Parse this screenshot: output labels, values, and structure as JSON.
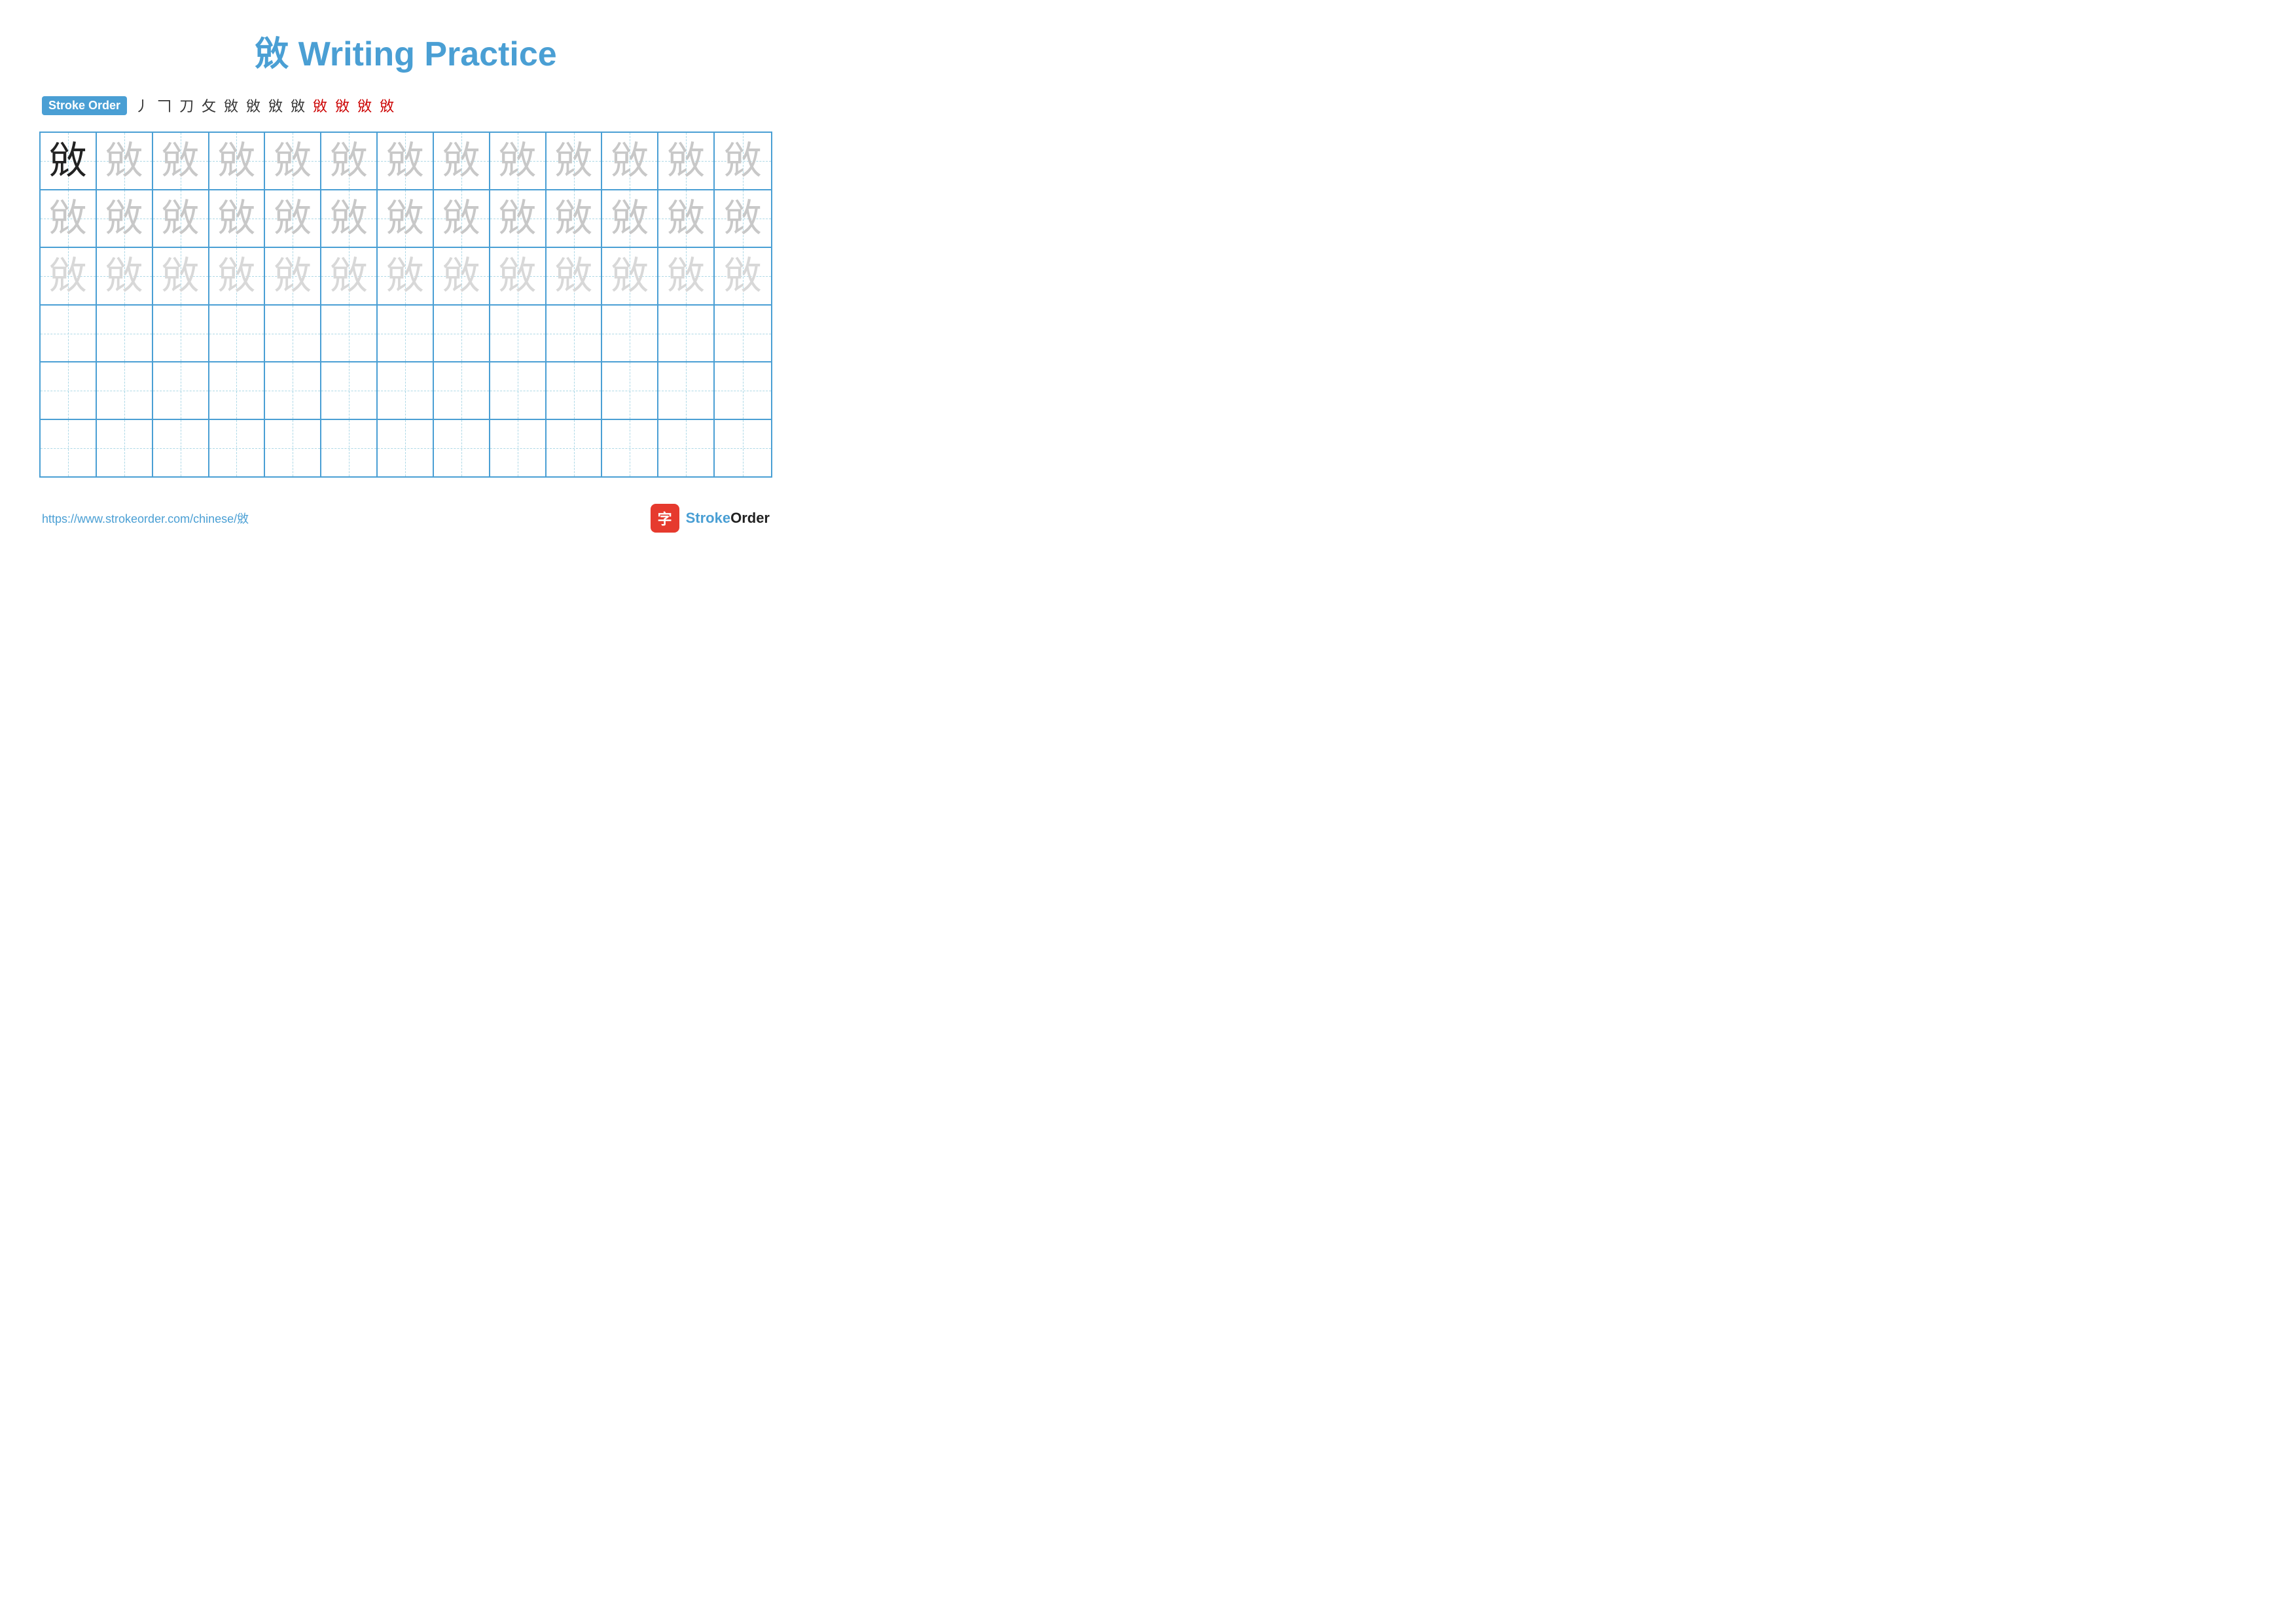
{
  "title": {
    "char": "敓",
    "label": "Writing Practice",
    "full": "敓 Writing Practice"
  },
  "stroke_order": {
    "badge": "Stroke Order",
    "steps": [
      {
        "char": "丿",
        "red": false
      },
      {
        "char": "𠃍",
        "red": false
      },
      {
        "char": "刀",
        "red": false
      },
      {
        "char": "攵",
        "red": false
      },
      {
        "char": "敓",
        "red": false
      },
      {
        "char": "敓",
        "red": false
      },
      {
        "char": "敓",
        "red": false
      },
      {
        "char": "敓",
        "red": false
      },
      {
        "char": "敓",
        "red": true
      },
      {
        "char": "敓",
        "red": true
      },
      {
        "char": "敓",
        "red": true
      },
      {
        "char": "敓",
        "red": true
      }
    ]
  },
  "grid": {
    "rows": 6,
    "cols": 13,
    "main_char": "敓",
    "row_styles": [
      "dark",
      "medium",
      "light",
      "empty",
      "empty",
      "empty"
    ]
  },
  "footer": {
    "url": "https://www.strokeorder.com/chinese/敓",
    "brand_icon": "字",
    "brand_name": "StrokeOrder"
  }
}
